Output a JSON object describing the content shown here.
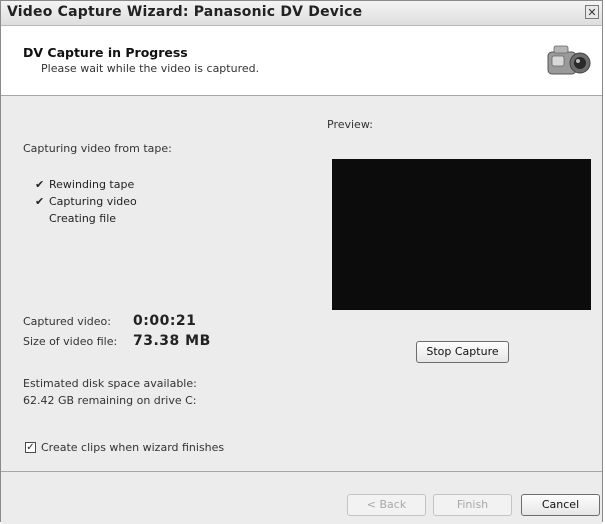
{
  "window": {
    "title": "Video Capture Wizard: Panasonic DV Device",
    "close_glyph": "✕"
  },
  "header": {
    "title": "DV Capture in Progress",
    "subtitle": "Please wait while the video is captured."
  },
  "capture": {
    "heading": "Capturing video from tape:",
    "steps": [
      {
        "label": "Rewinding tape",
        "done": true
      },
      {
        "label": "Capturing video",
        "done": true
      },
      {
        "label": "Creating file",
        "done": false
      }
    ],
    "check_glyph": "✔"
  },
  "preview": {
    "label": "Preview:"
  },
  "stats": {
    "captured_label": "Captured video:",
    "captured_value": "0:00:21",
    "size_label": "Size of video file:",
    "size_value": "73.38 MB",
    "disk_label": "Estimated disk space available:",
    "disk_value": "62.42 GB remaining on drive C:"
  },
  "buttons": {
    "stop_capture": "Stop Capture",
    "back": "< Back",
    "finish": "Finish",
    "cancel": "Cancel"
  },
  "options": {
    "create_clips_label": "Create clips when wizard finishes",
    "create_clips_checked": true,
    "check_glyph": "✓"
  }
}
